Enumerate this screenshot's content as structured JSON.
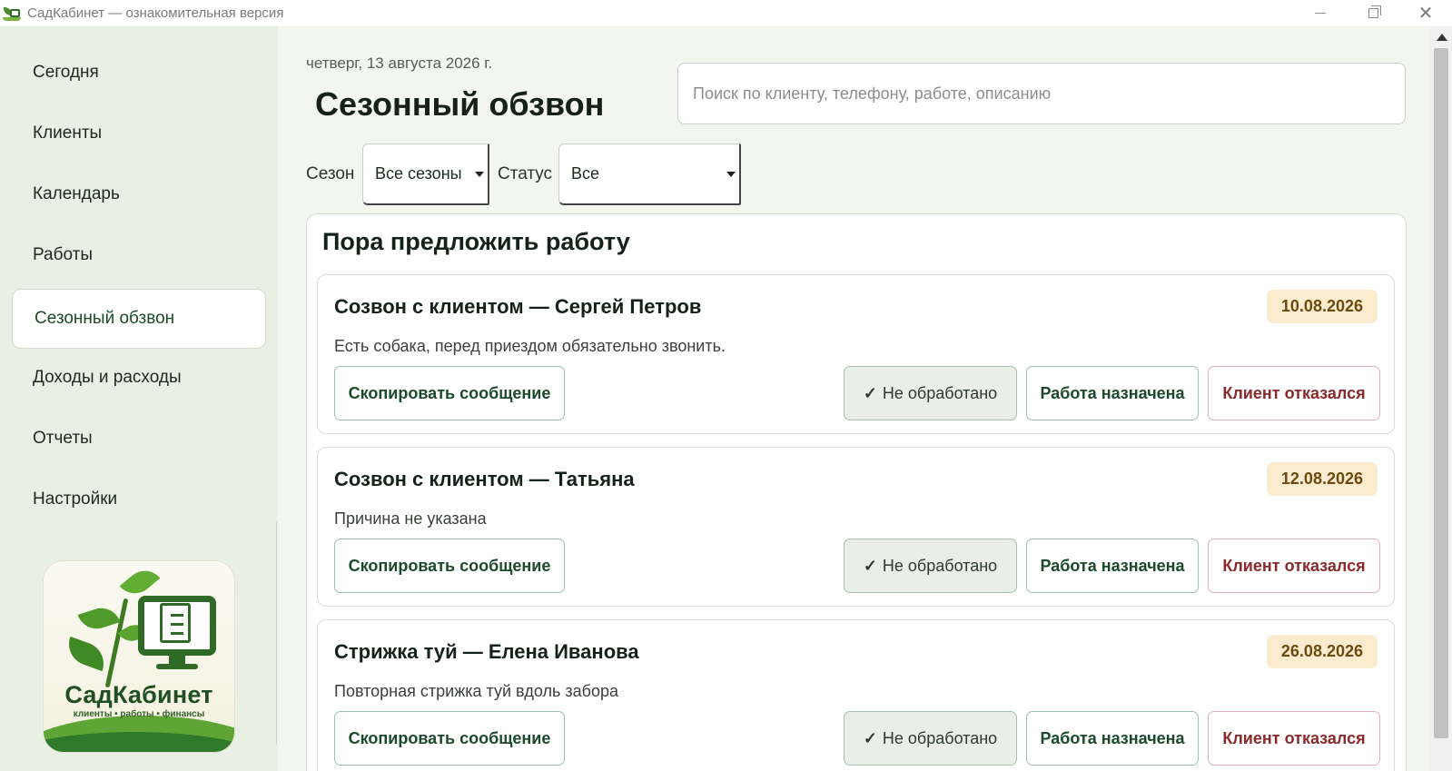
{
  "window": {
    "title": "СадКабинет — ознакомительная версия"
  },
  "sidebar": {
    "items": [
      {
        "label": "Сегодня"
      },
      {
        "label": "Клиенты"
      },
      {
        "label": "Календарь"
      },
      {
        "label": "Работы"
      },
      {
        "label": "Сезонный обзвон",
        "active": true
      },
      {
        "label": "Доходы и расходы"
      },
      {
        "label": "Отчеты"
      },
      {
        "label": "Настройки"
      }
    ],
    "logo": {
      "name": "СадКабинет",
      "tagline": "клиенты • работы • финансы"
    }
  },
  "header": {
    "date": "четверг, 13 августа 2026 г.",
    "title": "Сезонный обзвон"
  },
  "search": {
    "value": "",
    "placeholder": "Поиск по клиенту, телефону, работе, описанию"
  },
  "filters": {
    "season_label": "Сезон",
    "season_value": "Все сезоны",
    "status_label": "Статус",
    "status_value": "Все"
  },
  "section": {
    "title": "Пора предложить работу"
  },
  "cards": [
    {
      "title": "Созвон с клиентом — Сергей Петров",
      "date": "10.08.2026",
      "description": "Есть собака, перед приездом обязательно звонить.",
      "copy_label": "Скопировать сообщение",
      "pending_label": "Не обработано",
      "assigned_label": "Работа назначена",
      "refused_label": "Клиент отказался"
    },
    {
      "title": "Созвон с клиентом — Татьяна",
      "date": "12.08.2026",
      "description": "Причина не указана",
      "copy_label": "Скопировать сообщение",
      "pending_label": "Не обработано",
      "assigned_label": "Работа назначена",
      "refused_label": "Клиент отказался"
    },
    {
      "title": "Стрижка туй — Елена Иванова",
      "date": "26.08.2026",
      "description": "Повторная стрижка туй вдоль забора",
      "copy_label": "Скопировать сообщение",
      "pending_label": "Не обработано",
      "assigned_label": "Работа назначена",
      "refused_label": "Клиент отказался"
    }
  ],
  "icons": {
    "check": "✓",
    "app": "app-logo-icon",
    "dropdown": "dropdown-arrow-icon"
  },
  "colors": {
    "accent": "#1a4a2a",
    "sidebar_bg": "#e8f0e4",
    "date_badge_bg": "#fbecd0",
    "refuse_text": "#8a2a2a"
  }
}
